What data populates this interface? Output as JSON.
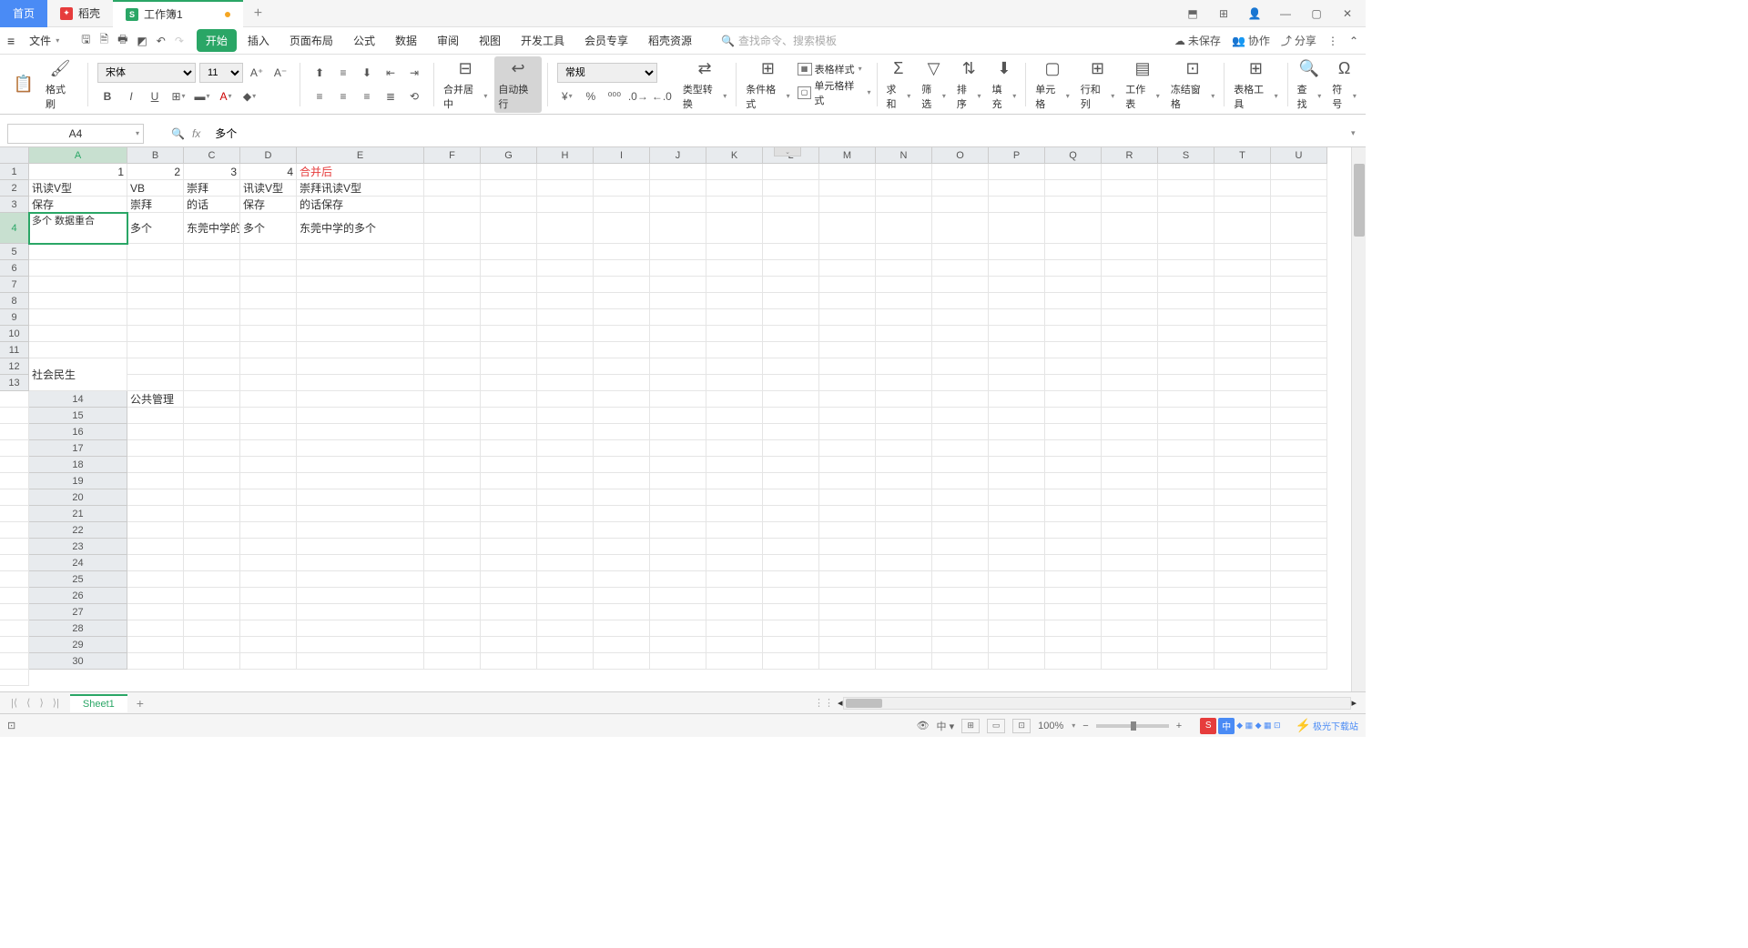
{
  "titlebar": {
    "home": "首页",
    "docer": "稻壳",
    "workbook": "工作簿1",
    "add": "+"
  },
  "menubar": {
    "file": "文件",
    "tabs": [
      "开始",
      "插入",
      "页面布局",
      "公式",
      "数据",
      "审阅",
      "视图",
      "开发工具",
      "会员专享",
      "稻壳资源"
    ],
    "search_placeholder": "查找命令、搜索模板",
    "unsaved": "未保存",
    "collab": "协作",
    "share": "分享"
  },
  "ribbon": {
    "format_painter": "格式刷",
    "font_name": "宋体",
    "font_size": "11",
    "merge_center": "合并居中",
    "auto_wrap": "自动换行",
    "number_format": "常规",
    "type_convert": "类型转换",
    "cond_format": "条件格式",
    "table_style": "表格样式",
    "cell_style": "单元格样式",
    "sum": "求和",
    "filter": "筛选",
    "sort": "排序",
    "fill": "填充",
    "cell": "单元格",
    "rowcol": "行和列",
    "worksheet": "工作表",
    "freeze": "冻结窗格",
    "tabletool": "表格工具",
    "find": "查找",
    "symbol": "符号"
  },
  "formula": {
    "cell_ref": "A4",
    "value": "多个"
  },
  "columns": [
    "A",
    "B",
    "C",
    "D",
    "E",
    "F",
    "G",
    "H",
    "I",
    "J",
    "K",
    "L",
    "M",
    "N",
    "O",
    "P",
    "Q",
    "R",
    "S",
    "T",
    "U"
  ],
  "rows_count": 30,
  "cells": {
    "r1": {
      "A": "1",
      "B": "2",
      "C": "3",
      "D": "4",
      "E": "合并后"
    },
    "r2": {
      "A": "讯读V型",
      "B": "VB",
      "C": "崇拜",
      "D": "讯读V型",
      "E": "崇拜讯读V型"
    },
    "r3": {
      "A": "保存",
      "B": "崇拜",
      "C": "的话",
      "D": "保存",
      "E": "的话保存"
    },
    "r4": {
      "A": "多个\n数据重合",
      "B": "多个",
      "C": "东莞中学的",
      "D": "多个",
      "E": "东莞中学的多个"
    },
    "r12": {
      "A": "社会民生"
    },
    "r14": {
      "A": "公共管理"
    }
  },
  "sheet": {
    "name": "Sheet1"
  },
  "status": {
    "zoom": "100%",
    "logo": "极光下载站"
  }
}
